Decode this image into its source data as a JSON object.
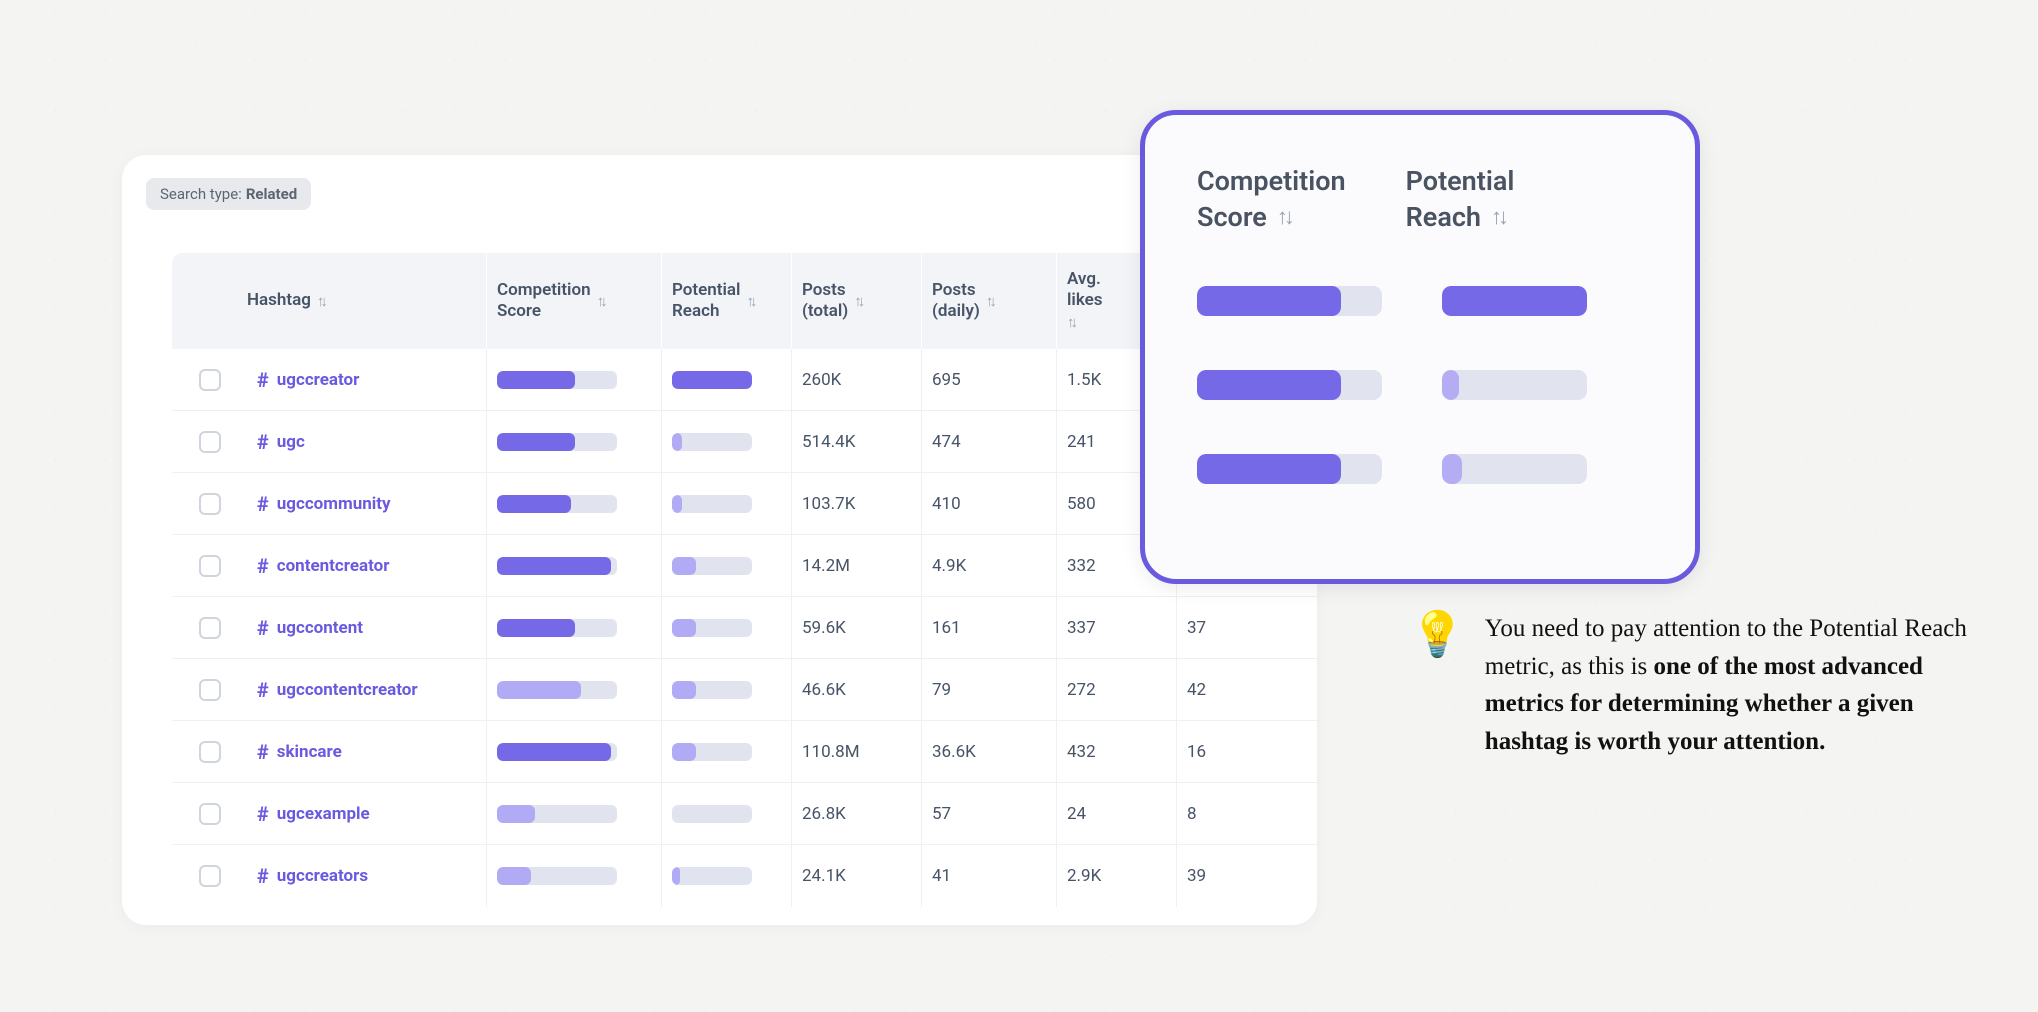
{
  "search_type": {
    "label": "Search type:",
    "value": "Related"
  },
  "columns": {
    "hashtag": "Hashtag",
    "competition": "Competition Score",
    "reach": "Potential Reach",
    "posts_total": "Posts (total)",
    "posts_daily": "Posts (daily)",
    "avg_likes": "Avg. likes"
  },
  "rows": [
    {
      "tag": "ugccreator",
      "comp_pct": 65,
      "comp_light": false,
      "reach_pct": 100,
      "reach_light": false,
      "posts_total": "260K",
      "posts_daily": "695",
      "avg_likes": "1.5K",
      "extra": ""
    },
    {
      "tag": "ugc",
      "comp_pct": 65,
      "comp_light": false,
      "reach_pct": 12,
      "reach_light": true,
      "posts_total": "514.4K",
      "posts_daily": "474",
      "avg_likes": "241",
      "extra": ""
    },
    {
      "tag": "ugccommunity",
      "comp_pct": 62,
      "comp_light": false,
      "reach_pct": 12,
      "reach_light": true,
      "posts_total": "103.7K",
      "posts_daily": "410",
      "avg_likes": "580",
      "extra": ""
    },
    {
      "tag": "contentcreator",
      "comp_pct": 95,
      "comp_light": false,
      "reach_pct": 30,
      "reach_light": true,
      "posts_total": "14.2M",
      "posts_daily": "4.9K",
      "avg_likes": "332",
      "extra": ""
    },
    {
      "tag": "ugccontent",
      "comp_pct": 65,
      "comp_light": false,
      "reach_pct": 30,
      "reach_light": true,
      "posts_total": "59.6K",
      "posts_daily": "161",
      "avg_likes": "337",
      "extra": "37"
    },
    {
      "tag": "ugccontentcreator",
      "comp_pct": 70,
      "comp_light": true,
      "reach_pct": 30,
      "reach_light": true,
      "posts_total": "46.6K",
      "posts_daily": "79",
      "avg_likes": "272",
      "extra": "42"
    },
    {
      "tag": "skincare",
      "comp_pct": 95,
      "comp_light": false,
      "reach_pct": 30,
      "reach_light": true,
      "posts_total": "110.8M",
      "posts_daily": "36.6K",
      "avg_likes": "432",
      "extra": "16"
    },
    {
      "tag": "ugcexample",
      "comp_pct": 32,
      "comp_light": true,
      "reach_pct": 0,
      "reach_light": true,
      "posts_total": "26.8K",
      "posts_daily": "57",
      "avg_likes": "24",
      "extra": "8"
    },
    {
      "tag": "ugccreators",
      "comp_pct": 28,
      "comp_light": true,
      "reach_pct": 10,
      "reach_light": true,
      "posts_total": "24.1K",
      "posts_daily": "41",
      "avg_likes": "2.9K",
      "extra": "39"
    }
  ],
  "callout": {
    "headers": {
      "competition": "Competition Score",
      "reach": "Potential Reach"
    },
    "rows": [
      {
        "comp_pct": 78,
        "comp_light": false,
        "reach_pct": 100,
        "reach_light": false
      },
      {
        "comp_pct": 78,
        "comp_light": false,
        "reach_pct": 12,
        "reach_light": true
      },
      {
        "comp_pct": 78,
        "comp_light": false,
        "reach_pct": 14,
        "reach_light": true
      }
    ]
  },
  "tip": {
    "icon": "💡",
    "text_plain": "You need to pay attention to the Potential Reach metric, as this is ",
    "text_bold": "one of the most advanced metrics for determining whether a given hashtag is worth your attention."
  }
}
